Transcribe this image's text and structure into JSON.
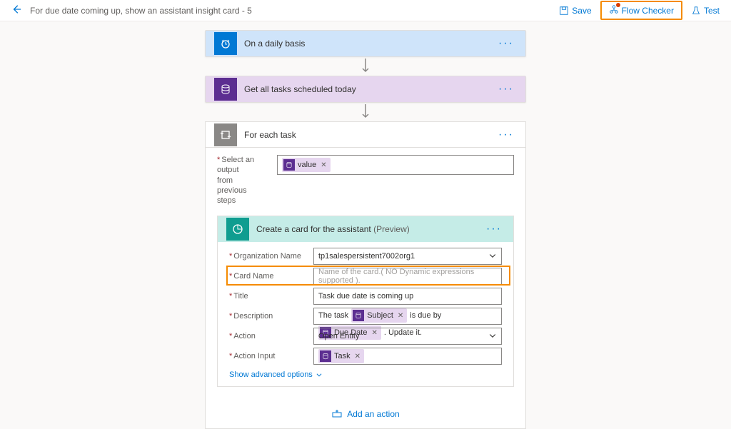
{
  "header": {
    "title": "For due date coming up, show an assistant insight card - 5",
    "save": "Save",
    "flow_checker": "Flow Checker",
    "test": "Test"
  },
  "trigger": {
    "title": "On a daily basis"
  },
  "step_tasks": {
    "title": "Get all tasks scheduled today"
  },
  "loop": {
    "title": "For each task",
    "select_label_1": "Select an output",
    "select_label_2": "from previous steps",
    "token_value": "value"
  },
  "create_card": {
    "title": "Create a card for the assistant ",
    "preview": "(Preview)",
    "org_label": "Organization Name",
    "org_value": "tp1salespersistent7002org1",
    "cardname_label": "Card Name",
    "cardname_placeholder": "Name of the card.( NO Dynamic expressions supported ).",
    "title_label": "Title",
    "title_value": "Task due date is coming up",
    "desc_label": "Description",
    "desc_pre": "The task",
    "desc_token1": "Subject",
    "desc_mid": "is due by",
    "desc_token2": "Due Date",
    "desc_post": ". Update it.",
    "action_label": "Action",
    "action_value": "Open Entity",
    "actioninput_label": "Action Input",
    "actioninput_token": "Task",
    "advanced": "Show advanced options"
  },
  "add_action": "Add an action"
}
